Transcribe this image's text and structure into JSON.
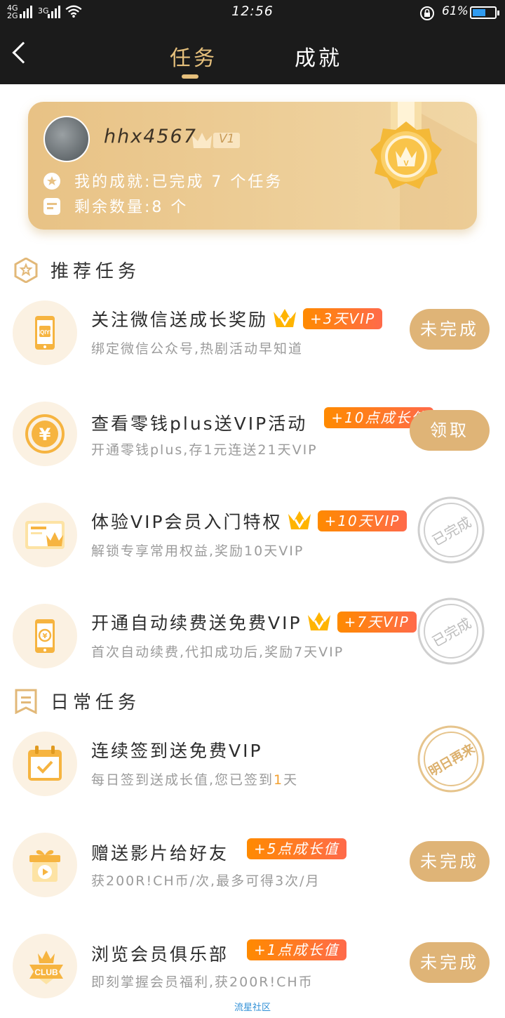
{
  "status_bar": {
    "net_left": "4G",
    "net_left2": "2G",
    "net_right": "3G",
    "time": "12:56",
    "battery": "61%",
    "battery_level": 0.61
  },
  "nav": {
    "tab_task": "任务",
    "tab_achievement": "成就"
  },
  "profile": {
    "username": "hhx4567",
    "vip_level": "V1",
    "achievement": "我的成就:已完成 7 个任务",
    "remaining": "剩余数量:8 个"
  },
  "sections": {
    "recommended": "推荐任务",
    "daily": "日常任务"
  },
  "tasks": [
    {
      "title": "关注微信送成长奖励",
      "reward": "+3天VIP",
      "desc": "绑定微信公众号,热剧活动早知道",
      "action": "未完成",
      "icon": "iqiyi-phone-icon"
    },
    {
      "title": "查看零钱plus送VIP活动",
      "reward": "+10点成长值",
      "desc": "开通零钱plus,存1元连送21天VIP",
      "action": "领取",
      "icon": "yuan-coin-icon"
    },
    {
      "title": "体验VIP会员入门特权",
      "reward": "+10天VIP",
      "desc": "解锁专享常用权益,奖励10天VIP",
      "action": "已完成",
      "icon": "vip-card-icon"
    },
    {
      "title": "开通自动续费送免费VIP",
      "reward": "+7天VIP",
      "desc": "首次自动续费,代扣成功后,奖励7天VIP",
      "action": "已完成",
      "icon": "auto-renew-phone-icon"
    },
    {
      "title": "连续签到送免费VIP",
      "desc_prefix": "每日签到送成长值,您已签到",
      "desc_num": "1",
      "desc_suffix": "天",
      "action": "明日再来",
      "icon": "calendar-check-icon"
    },
    {
      "title": "赠送影片给好友",
      "reward": "+5点成长值",
      "desc": "获200R!CH币/次,最多可得3次/月",
      "action": "未完成",
      "icon": "gift-play-icon"
    },
    {
      "title": "浏览会员俱乐部",
      "reward": "+1点成长值",
      "desc": "即刻掌握会员福利,获200R!CH币",
      "action": "未完成",
      "icon": "club-badge-icon"
    }
  ],
  "footer": "流星社区",
  "colors": {
    "gold": "#dfb477",
    "tab_active": "#e6c07c",
    "reward_orange": "#ff8a00"
  }
}
